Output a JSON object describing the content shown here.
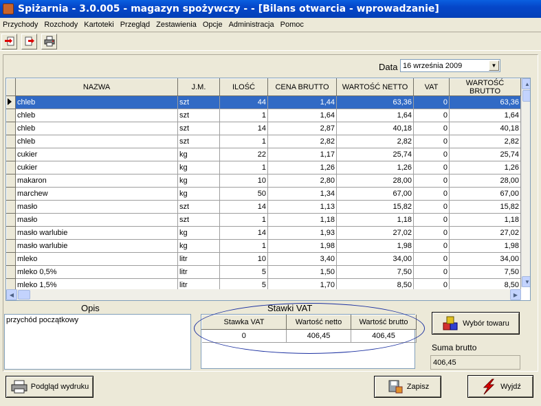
{
  "window": {
    "title": "Spiżarnia - 3.0.005 - magazyn spożywczy -  - [Bilans otwarcia - wprowadzanie]"
  },
  "menu": [
    "Przychody",
    "Rozchody",
    "Kartoteki",
    "Przegląd",
    "Zestawienia",
    "Opcje",
    "Administracja",
    "Pomoc"
  ],
  "toolbar": {
    "icons": [
      "add-document-icon",
      "exit-document-icon",
      "print-icon"
    ]
  },
  "date": {
    "label": "Data",
    "value": "16  września   2009"
  },
  "grid": {
    "columns": [
      "NAZWA",
      "J.M.",
      "ILOŚĆ",
      "CENA BRUTTO",
      "WARTOŚĆ NETTO",
      "VAT",
      "WARTOŚĆ BRUTTO"
    ],
    "rows": [
      [
        "chleb",
        "szt",
        "44",
        "1,44",
        "63,36",
        "0",
        "63,36"
      ],
      [
        "chleb",
        "szt",
        "1",
        "1,64",
        "1,64",
        "0",
        "1,64"
      ],
      [
        "chleb",
        "szt",
        "14",
        "2,87",
        "40,18",
        "0",
        "40,18"
      ],
      [
        "chleb",
        "szt",
        "1",
        "2,82",
        "2,82",
        "0",
        "2,82"
      ],
      [
        "cukier",
        "kg",
        "22",
        "1,17",
        "25,74",
        "0",
        "25,74"
      ],
      [
        "cukier",
        "kg",
        "1",
        "1,26",
        "1,26",
        "0",
        "1,26"
      ],
      [
        "makaron",
        "kg",
        "10",
        "2,80",
        "28,00",
        "0",
        "28,00"
      ],
      [
        "marchew",
        "kg",
        "50",
        "1,34",
        "67,00",
        "0",
        "67,00"
      ],
      [
        "masło",
        "szt",
        "14",
        "1,13",
        "15,82",
        "0",
        "15,82"
      ],
      [
        "masło",
        "szt",
        "1",
        "1,18",
        "1,18",
        "0",
        "1,18"
      ],
      [
        "masło warlubie",
        "kg",
        "14",
        "1,93",
        "27,02",
        "0",
        "27,02"
      ],
      [
        "masło warlubie",
        "kg",
        "1",
        "1,98",
        "1,98",
        "0",
        "1,98"
      ],
      [
        "mleko",
        "litr",
        "10",
        "3,40",
        "34,00",
        "0",
        "34,00"
      ],
      [
        "mleko 0,5%",
        "litr",
        "5",
        "1,50",
        "7,50",
        "0",
        "7,50"
      ],
      [
        "mleko 1,5%",
        "litr",
        "5",
        "1,70",
        "8,50",
        "0",
        "8,50"
      ]
    ],
    "selected_row": 0
  },
  "opis": {
    "label": "Opis",
    "value": "przychód początkowy"
  },
  "vat": {
    "label": "Stawki VAT",
    "columns": [
      "Stawka VAT",
      "Wartość netto",
      "Wartość brutto"
    ],
    "rows": [
      [
        "0",
        "406,45",
        "406,45"
      ]
    ]
  },
  "buttons": {
    "wybor": "Wybór towaru",
    "podglad": "Podgląd wydruku",
    "zapisz": "Zapisz",
    "wyjdz": "Wyjdź"
  },
  "suma": {
    "label": "Suma brutto",
    "value": "406,45"
  },
  "colors": {
    "title_bar": "#0546c8",
    "selection": "#316ac5",
    "highlight_ellipse": "#1a2fa0"
  }
}
